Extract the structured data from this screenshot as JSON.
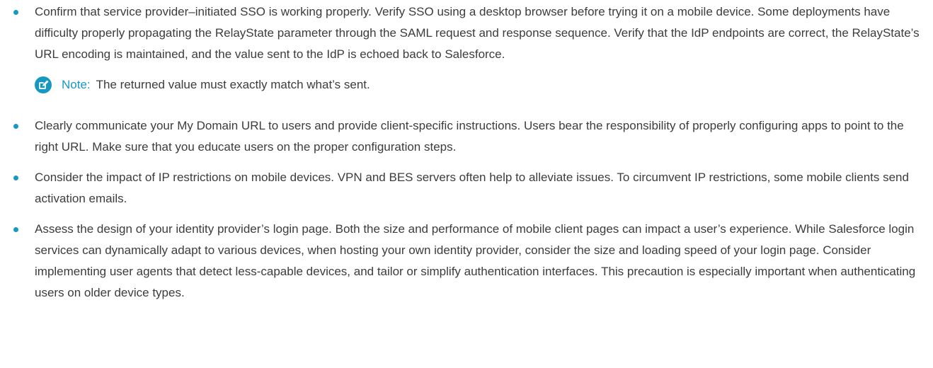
{
  "bullets": [
    {
      "text": "Confirm that service provider–initiated SSO is working properly. Verify SSO using a desktop browser before trying it on a mobile device. Some deployments have difficulty properly propagating the RelayState parameter through the SAML request and response sequence. Verify that the IdP endpoints are correct, the RelayState’s URL encoding is maintained, and the value sent to the IdP is echoed back to Salesforce."
    },
    {
      "text": "Clearly communicate your My Domain URL to users and provide client-specific instructions. Users bear the responsibility of properly configuring apps to point to the right URL. Make sure that you educate users on the proper configuration steps."
    },
    {
      "text": "Consider the impact of IP restrictions on mobile devices. VPN and BES servers often help to alleviate issues. To circumvent IP restrictions, some mobile clients send activation emails."
    },
    {
      "text": "Assess the design of your identity provider’s login page. Both the size and performance of mobile client pages can impact a user’s experience. While Salesforce login services can dynamically adapt to various devices, when hosting your own identity provider, consider the size and loading speed of your login page. Consider implementing user agents that detect less-capable devices, and tailor or simplify authentication interfaces. This precaution is especially important when authenticating users on older device types."
    }
  ],
  "note": {
    "label": "Note:",
    "text": "The returned value must exactly match what’s sent.",
    "icon": "note-edit-icon"
  },
  "colors": {
    "accent": "#1798c1",
    "text": "#3c3c3c"
  }
}
